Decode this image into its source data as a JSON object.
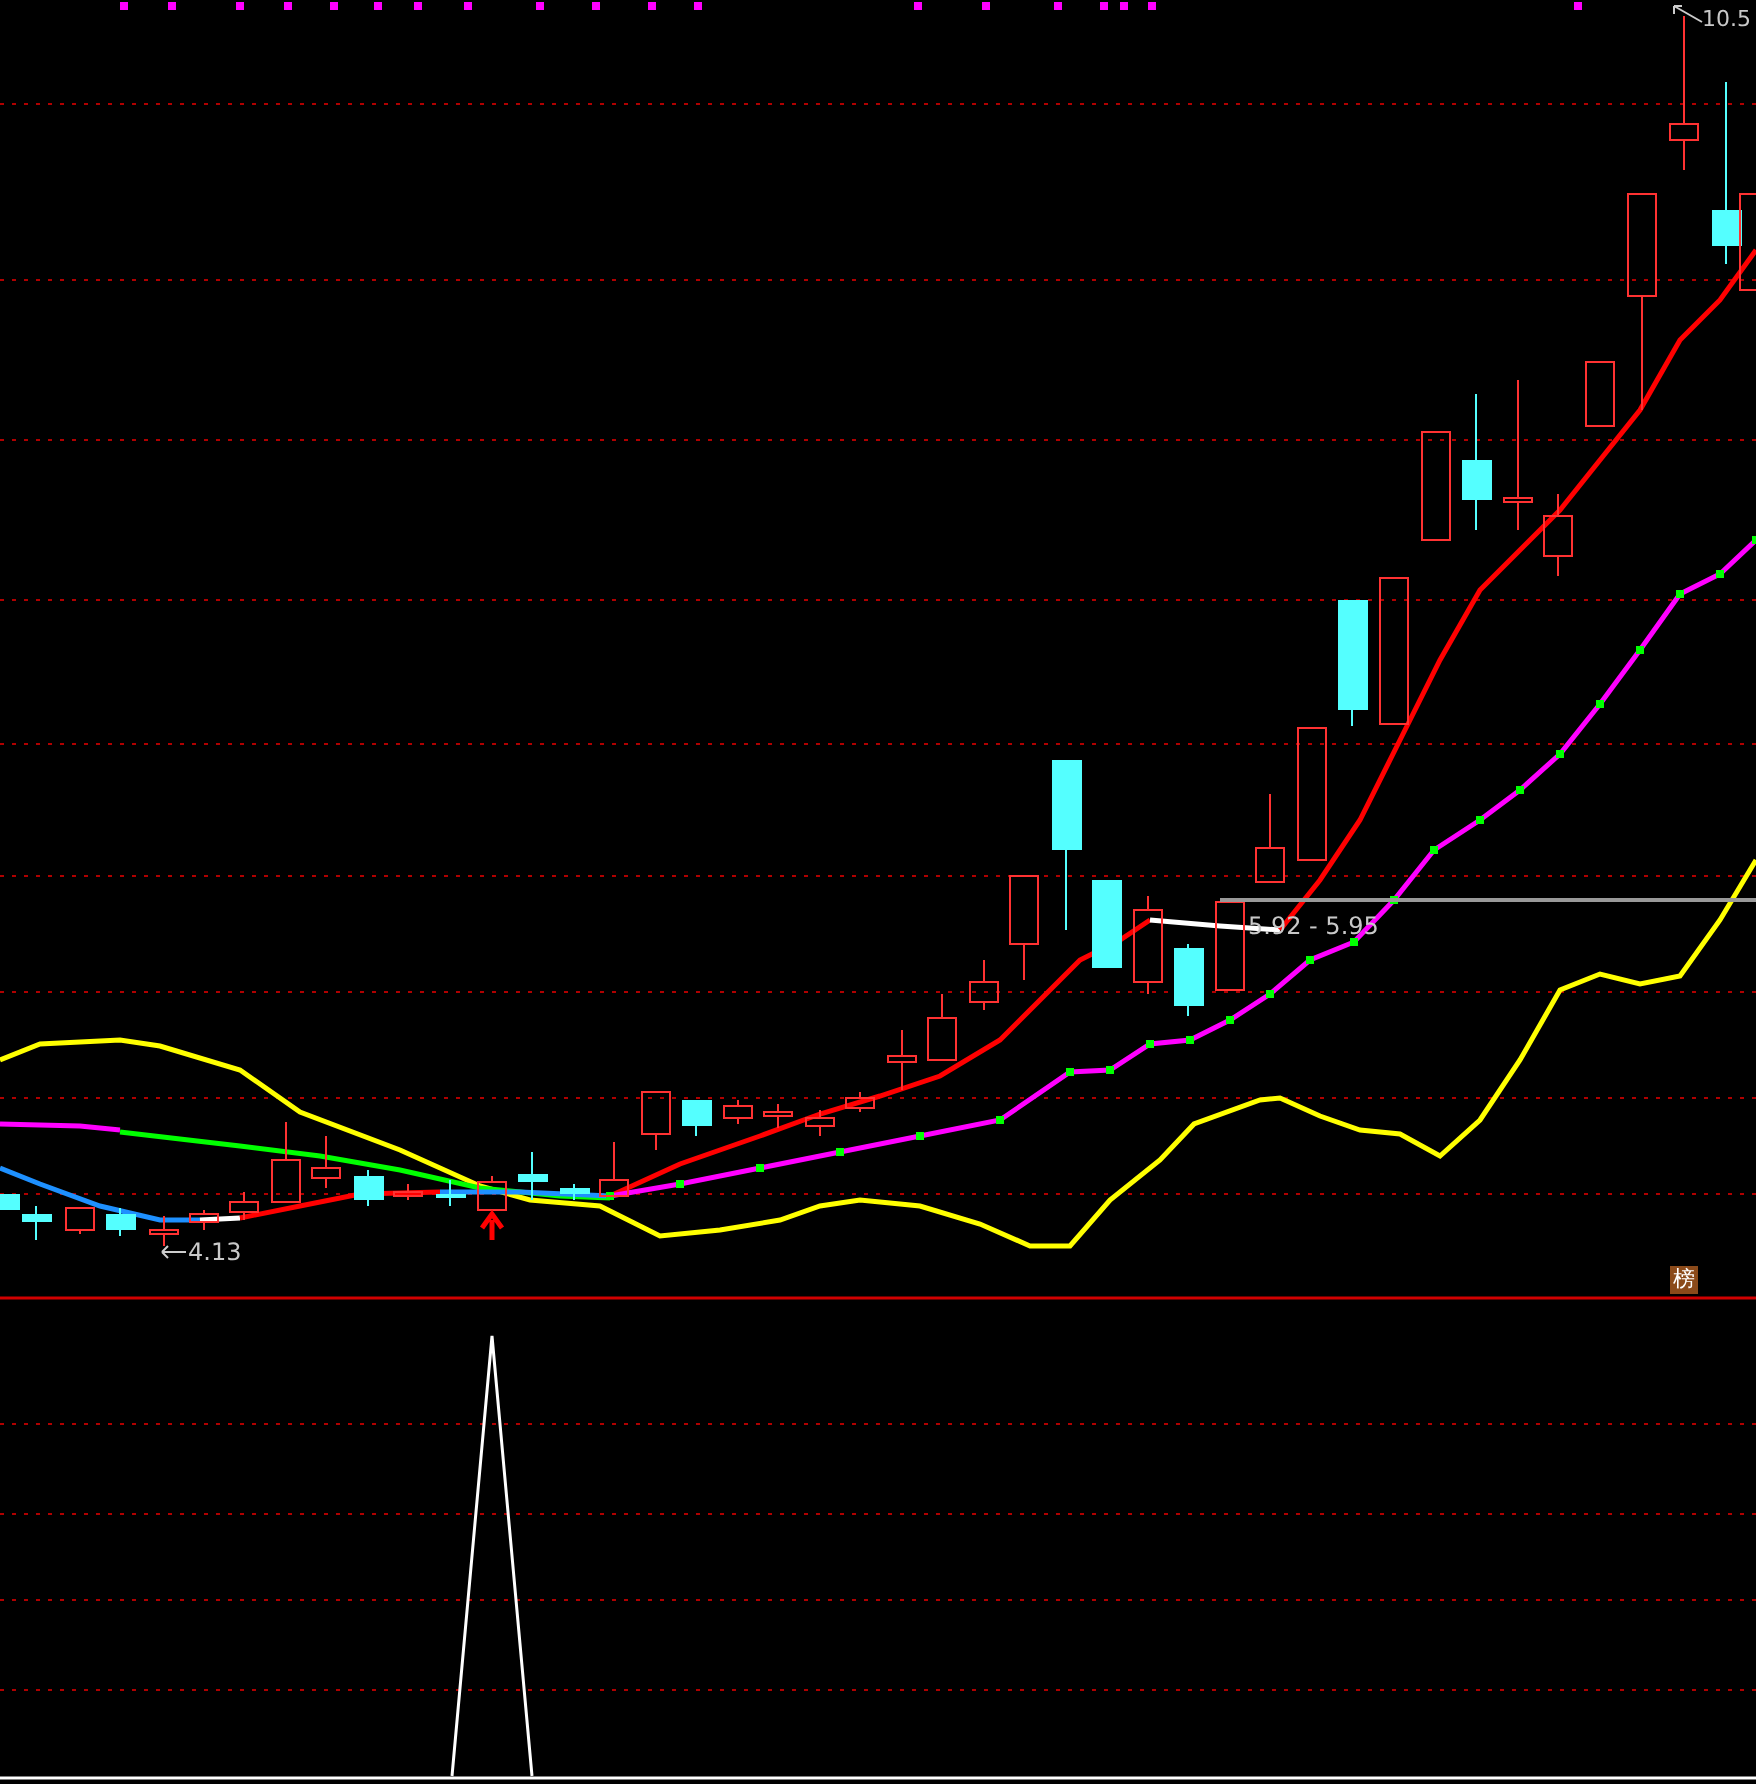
{
  "price_panel": {
    "high_label": "10.5",
    "low_label": "4.13",
    "range_label": "5.92 - 5.95",
    "badge": "榜"
  }
}
